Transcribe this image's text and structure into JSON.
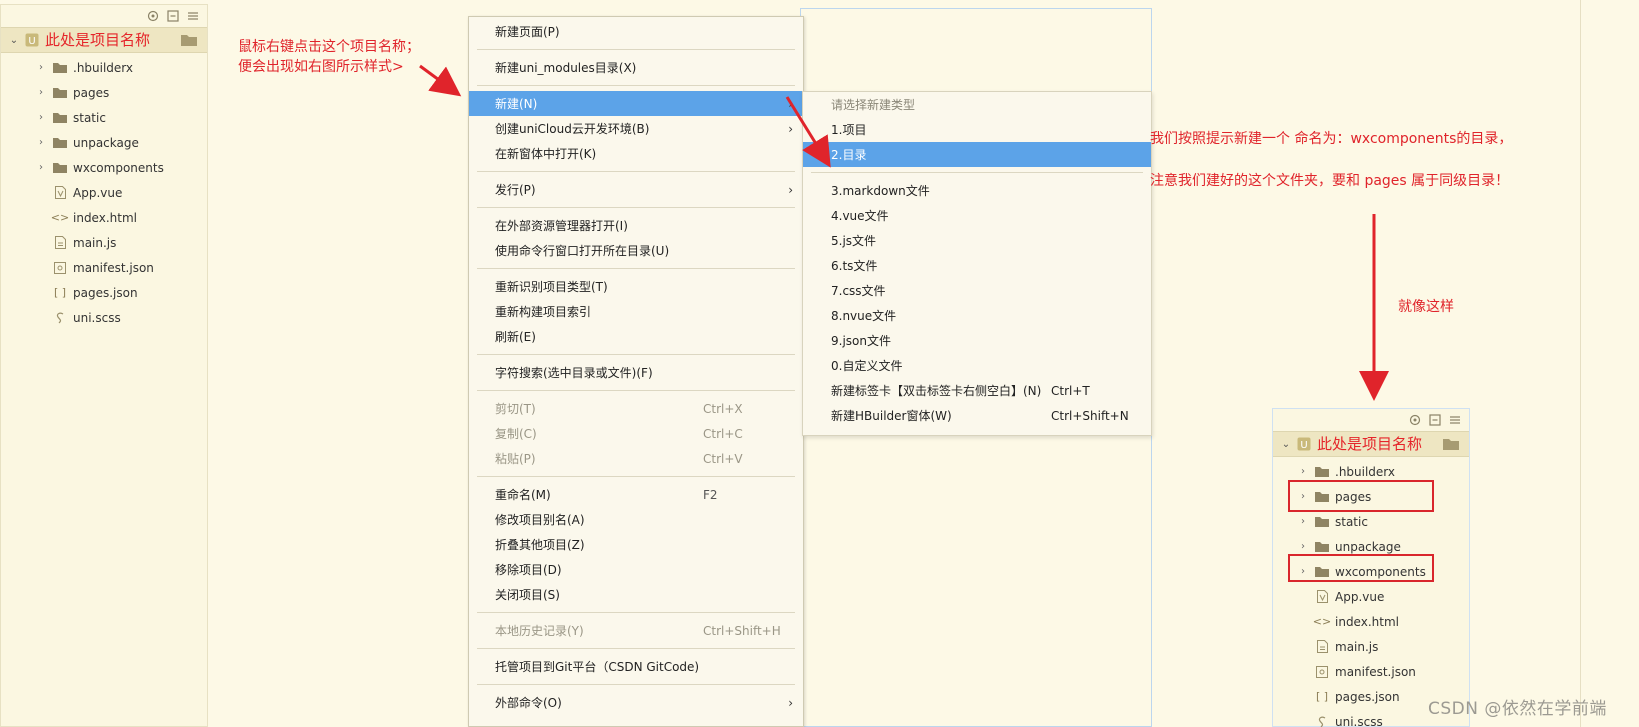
{
  "left_panel": {
    "toolbar_icons": [
      "locate-icon",
      "collapse-icon",
      "menu-icon"
    ],
    "project_name": "此处是项目名称",
    "items": [
      {
        "label": ".hbuilderx",
        "kind": "folder",
        "expandable": true
      },
      {
        "label": "pages",
        "kind": "folder",
        "expandable": true
      },
      {
        "label": "static",
        "kind": "folder",
        "expandable": true
      },
      {
        "label": "unpackage",
        "kind": "folder",
        "expandable": true
      },
      {
        "label": "wxcomponents",
        "kind": "folder",
        "expandable": true
      },
      {
        "label": "App.vue",
        "kind": "vue-file",
        "expandable": false
      },
      {
        "label": "index.html",
        "kind": "html-file",
        "expandable": false
      },
      {
        "label": "main.js",
        "kind": "js-file",
        "expandable": false
      },
      {
        "label": "manifest.json",
        "kind": "manifest-file",
        "expandable": false
      },
      {
        "label": "pages.json",
        "kind": "json-file",
        "expandable": false
      },
      {
        "label": "uni.scss",
        "kind": "scss-file",
        "expandable": false
      }
    ]
  },
  "annotations": {
    "left_note_line1": "鼠标右键点击这个项目名称；",
    "left_note_line2": "便会出现如右图所示样式>",
    "right_note_line1": "我们按照提示新建一个 命名为：wxcomponents的目录，",
    "right_note_line2": "注意我们建好的这个文件夹，要和 pages 属于同级目录！",
    "right_note_line3": "就像这样",
    "accent_color": "#e0242b"
  },
  "context_menu": {
    "highlight_color": "#5ca3e8",
    "groups": [
      [
        {
          "label": "新建页面(P)"
        }
      ],
      [
        {
          "label": "新建uni_modules目录(X)"
        }
      ],
      [
        {
          "label": "新建(N)",
          "submenu": true,
          "highlighted": true
        },
        {
          "label": "创建uniCloud云开发环境(B)",
          "submenu": true
        },
        {
          "label": "在新窗体中打开(K)"
        }
      ],
      [
        {
          "label": "发行(P)",
          "submenu": true
        }
      ],
      [
        {
          "label": "在外部资源管理器打开(I)"
        },
        {
          "label": "使用命令行窗口打开所在目录(U)"
        }
      ],
      [
        {
          "label": "重新识别项目类型(T)"
        },
        {
          "label": "重新构建项目索引"
        },
        {
          "label": "刷新(E)"
        }
      ],
      [
        {
          "label": "字符搜索(选中目录或文件)(F)"
        }
      ],
      [
        {
          "label": "剪切(T)",
          "shortcut": "Ctrl+X",
          "disabled": true
        },
        {
          "label": "复制(C)",
          "shortcut": "Ctrl+C",
          "disabled": true
        },
        {
          "label": "粘贴(P)",
          "shortcut": "Ctrl+V",
          "disabled": true
        }
      ],
      [
        {
          "label": "重命名(M)",
          "shortcut": "F2"
        },
        {
          "label": "修改项目别名(A)"
        },
        {
          "label": "折叠其他项目(Z)"
        },
        {
          "label": "移除项目(D)"
        },
        {
          "label": "关闭项目(S)"
        }
      ],
      [
        {
          "label": "本地历史记录(Y)",
          "shortcut": "Ctrl+Shift+H",
          "disabled": true
        }
      ],
      [
        {
          "label": "托管项目到Git平台（CSDN GitCode)"
        }
      ],
      [
        {
          "label": "外部命令(O)",
          "submenu": true
        }
      ]
    ]
  },
  "submenu": {
    "header": "请选择新建类型",
    "group1": [
      {
        "label": "1.项目"
      },
      {
        "label": "2.目录",
        "highlighted": true
      }
    ],
    "group2": [
      {
        "label": "3.markdown文件"
      },
      {
        "label": "4.vue文件"
      },
      {
        "label": "5.js文件"
      },
      {
        "label": "6.ts文件"
      },
      {
        "label": "7.css文件"
      },
      {
        "label": "8.nvue文件"
      },
      {
        "label": "9.json文件"
      },
      {
        "label": "0.自定义文件"
      },
      {
        "label": "新建标签卡【双击标签卡右侧空白】(N)",
        "shortcut": "Ctrl+T"
      },
      {
        "label": "新建HBuilder窗体(W)",
        "shortcut": "Ctrl+Shift+N"
      }
    ]
  },
  "right_panel": {
    "project_name": "此处是项目名称",
    "items": [
      {
        "label": ".hbuilderx",
        "kind": "folder",
        "expandable": true
      },
      {
        "label": "pages",
        "kind": "folder",
        "expandable": true,
        "boxed": true
      },
      {
        "label": "static",
        "kind": "folder",
        "expandable": true
      },
      {
        "label": "unpackage",
        "kind": "folder",
        "expandable": true
      },
      {
        "label": "wxcomponents",
        "kind": "folder",
        "expandable": true,
        "boxed": true
      },
      {
        "label": "App.vue",
        "kind": "vue-file",
        "expandable": false
      },
      {
        "label": "index.html",
        "kind": "html-file",
        "expandable": false
      },
      {
        "label": "main.js",
        "kind": "js-file",
        "expandable": false
      },
      {
        "label": "manifest.json",
        "kind": "manifest-file",
        "expandable": false
      },
      {
        "label": "pages.json",
        "kind": "json-file",
        "expandable": false
      },
      {
        "label": "uni.scss",
        "kind": "scss-file",
        "expandable": false
      }
    ]
  },
  "watermark": "CSDN @依然在学前端"
}
